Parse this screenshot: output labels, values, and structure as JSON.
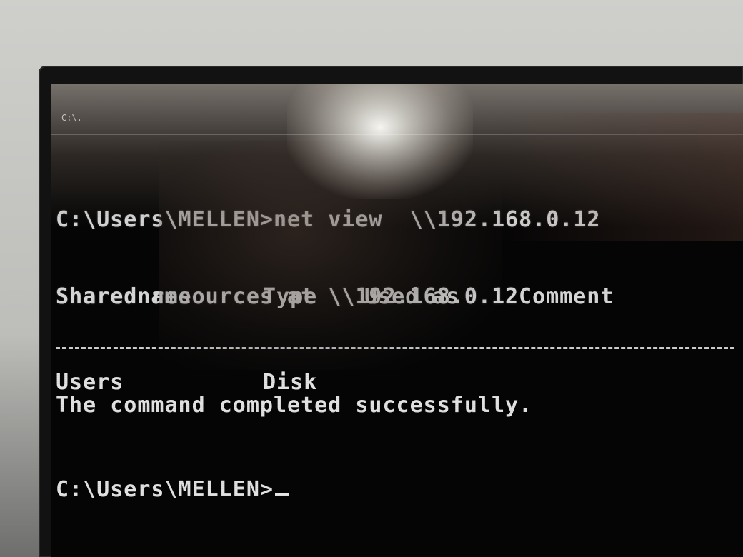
{
  "window": {
    "title_icon_label": "C:\\."
  },
  "console": {
    "lines": [
      "C:\\Users\\MELLEN>net view  \\\\192.168.0.12",
      "Shared resources at \\\\192.168.0.12"
    ],
    "table": {
      "headers": [
        "Share name",
        "Type",
        "Used as",
        "Comment"
      ],
      "rows": [
        {
          "share_name": "Users",
          "type": "Disk",
          "used_as": "",
          "comment": ""
        }
      ]
    },
    "status": "The command completed successfully.",
    "prompt": "C:\\Users\\MELLEN>"
  },
  "colors": {
    "text": "#d6d6d6",
    "background": "#050505"
  }
}
